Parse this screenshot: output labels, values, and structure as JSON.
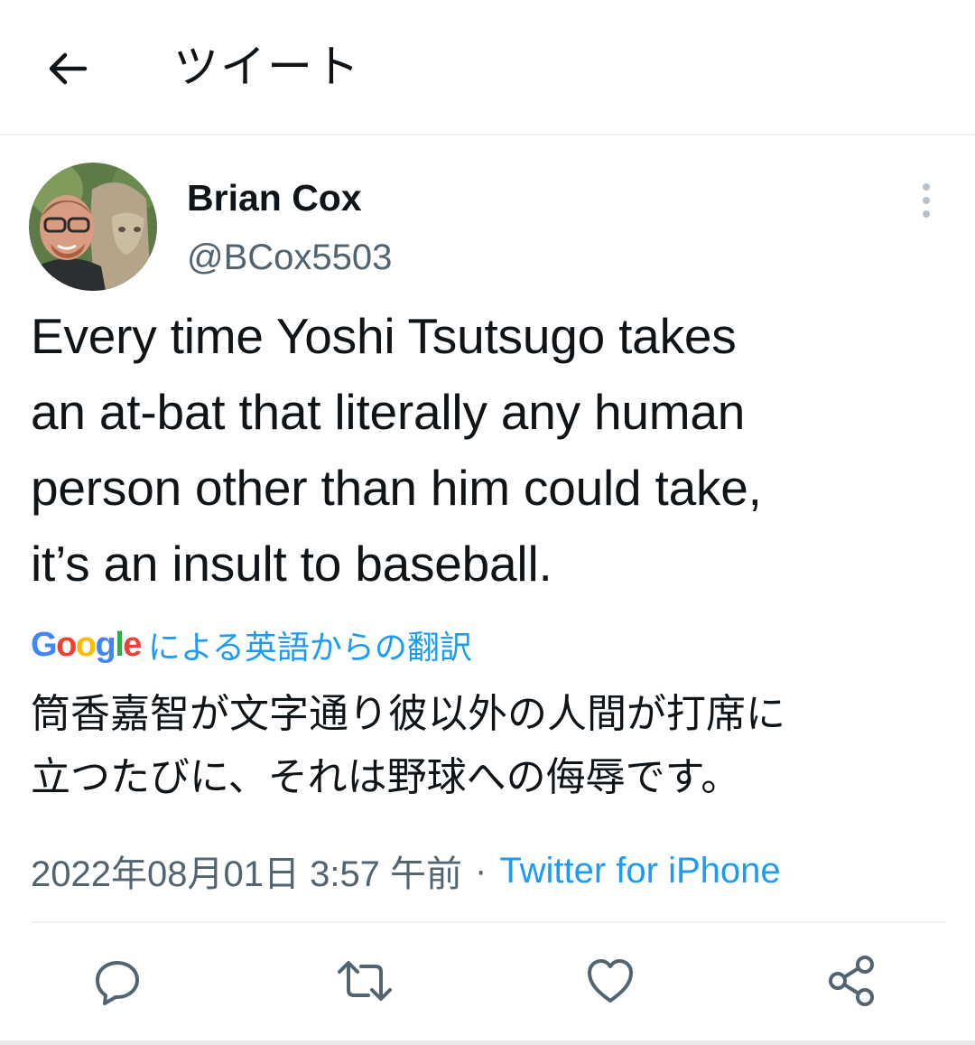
{
  "header": {
    "back_icon": "arrow-left-icon",
    "title": "ツイート"
  },
  "author": {
    "name": "Brian Cox",
    "handle": "@BCox5503",
    "avatar_icon": "avatar-photo",
    "more_icon": "more-vertical-icon"
  },
  "tweet": {
    "text": "Every time Yoshi Tsutsugo takes\nan at-bat that literally any human\nperson other than him could take,\nit’s an insult to baseball."
  },
  "translation": {
    "google_logo": [
      "G",
      "o",
      "o",
      "g",
      "l",
      "e"
    ],
    "label": "による英語からの翻訳",
    "text": "筒香嘉智が文字通り彼以外の人間が打席に\n立つたびに、それは野球への侮辱です。"
  },
  "meta": {
    "timestamp": "2022年08月01日 3:57 午前",
    "separator": "·",
    "source": "Twitter for iPhone"
  },
  "actions": [
    {
      "icon": "reply-icon"
    },
    {
      "icon": "retweet-icon"
    },
    {
      "icon": "like-icon"
    },
    {
      "icon": "share-icon"
    }
  ],
  "colors": {
    "accent": "#1d9bf0",
    "secondary_text": "#536471",
    "primary_text": "#0f1419",
    "google_blue": "#4285F4",
    "google_red": "#EA4335",
    "google_yellow": "#FBBC05",
    "google_green": "#34A853"
  }
}
